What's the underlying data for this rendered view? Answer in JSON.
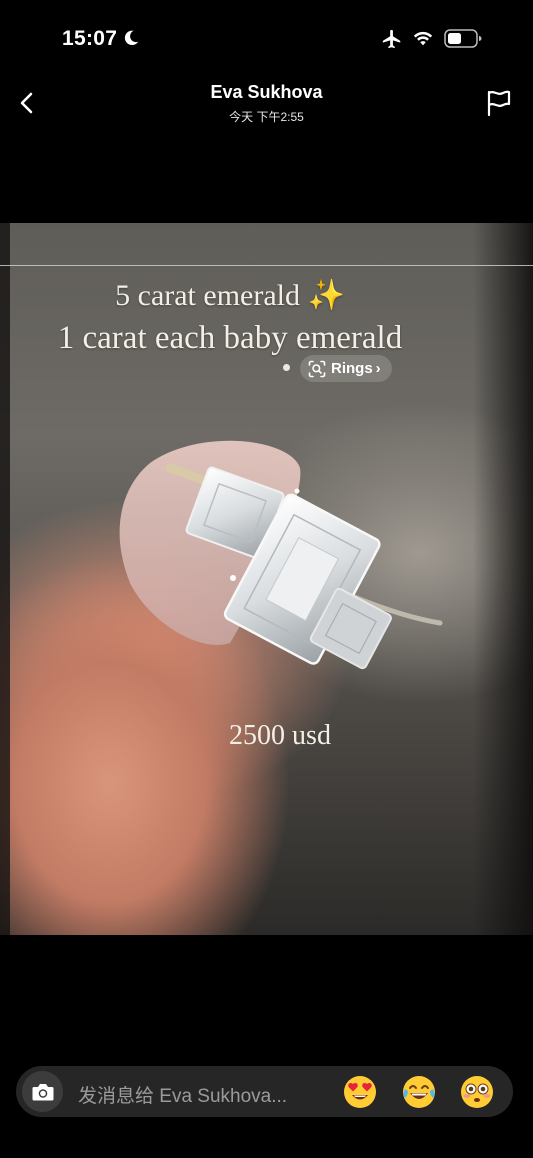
{
  "status_bar": {
    "time": "15:07",
    "icons": [
      "moon-icon",
      "airplane-icon",
      "wifi-icon",
      "battery-icon"
    ]
  },
  "header": {
    "contact_name": "Eva Sukhova",
    "timestamp": "今天 下午2:55",
    "icons": [
      "chevron-left-icon",
      "flag-icon"
    ]
  },
  "story": {
    "caption_line_1": "5 carat emerald ✨",
    "caption_line_2": "1 carat each baby emerald",
    "price": "2500 usd",
    "lens_chip_label": "Rings",
    "lens_chip_chevron": "›"
  },
  "composer": {
    "placeholder": "发消息给 Eva Sukhova...",
    "quick_reactions": [
      "😍",
      "😂",
      "😳"
    ]
  },
  "colors": {
    "background": "#000000",
    "composer_bg": "#262626",
    "placeholder": "#9b9b9b"
  }
}
